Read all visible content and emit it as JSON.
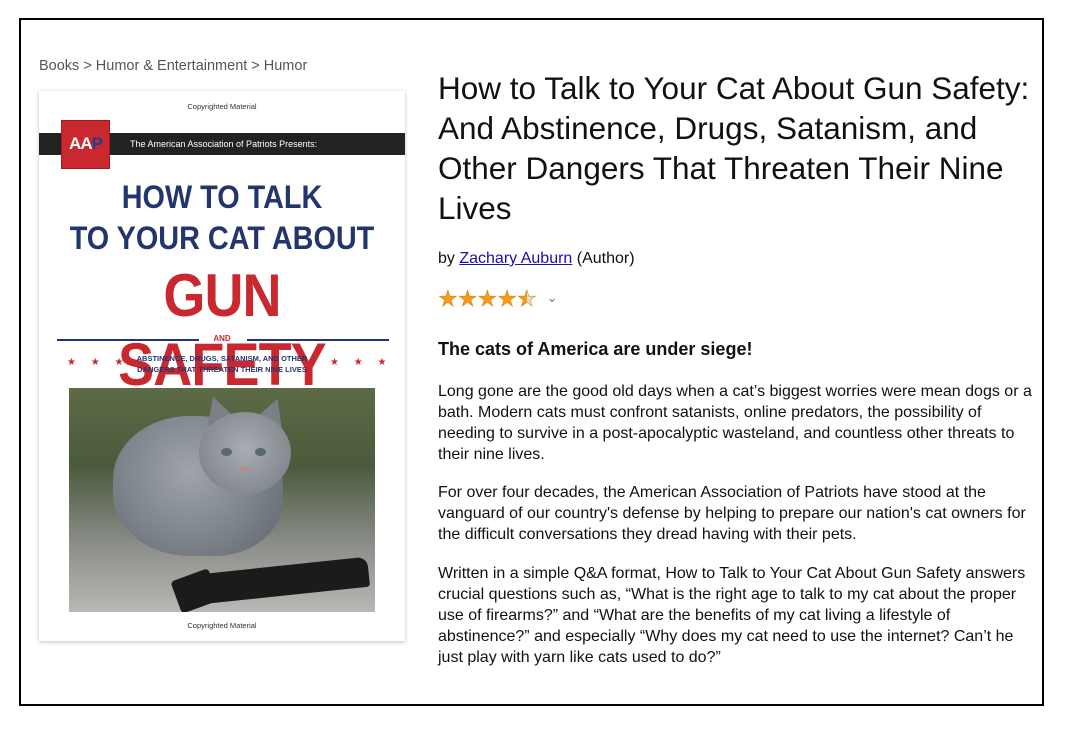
{
  "breadcrumb": {
    "items": [
      "Books",
      "Humor & Entertainment",
      "Humor"
    ],
    "separator": ">"
  },
  "cover": {
    "copyright_top": "Copyrighted Material",
    "copyright_bottom": "Copyrighted Material",
    "logo_text": "AAP",
    "banner": "The American Association of Patriots Presents:",
    "title_line1": "HOW TO TALK",
    "title_line2": "TO YOUR CAT ABOUT",
    "title_line3": "GUN SAFETY",
    "and": "AND",
    "subtitle": "ABSTINENCE, DRUGS, SATANISM, AND OTHER DANGERS THAT THREATEN THEIR NINE LIVES",
    "stars_left": "★ ★ ★",
    "stars_right": "★ ★ ★"
  },
  "book": {
    "title": "How to Talk to Your Cat About Gun Safety: And Abstinence, Drugs, Satanism, and Other Dangers That Threaten Their Nine Lives",
    "by": "by",
    "author": "Zachary Auburn",
    "role": "(Author)",
    "rating": 4.5,
    "rating_max": 5,
    "star_color": "#f59c1d",
    "rating_chevron": "⌄"
  },
  "description": {
    "headline": "The cats of America are under siege!",
    "p1": "Long gone are the good old days when a cat’s biggest worries were mean dogs or a bath. Modern cats must confront satanists, online predators, the possibility of needing to survive in a post-apocalyptic wasteland, and countless other threats to their nine lives.",
    "p2": "For over four decades, the American Association of Patriots have stood at the vanguard of our country's defense by helping to prepare our nation's cat owners for the difficult conversations they dread having with their pets.",
    "p3": "Written in a simple Q&A format, How to Talk to Your Cat About Gun Safety answers crucial questions such as, “What is the right age to talk to my cat about the proper use of firearms?” and “What are the benefits of my cat living a lifestyle of abstinence?” and especially “Why does my cat need to use the internet? Can’t he just play with yarn like cats used to do?”"
  },
  "colors": {
    "link": "#1a0dab",
    "cover_blue": "#23356e",
    "cover_red": "#c8282e"
  }
}
